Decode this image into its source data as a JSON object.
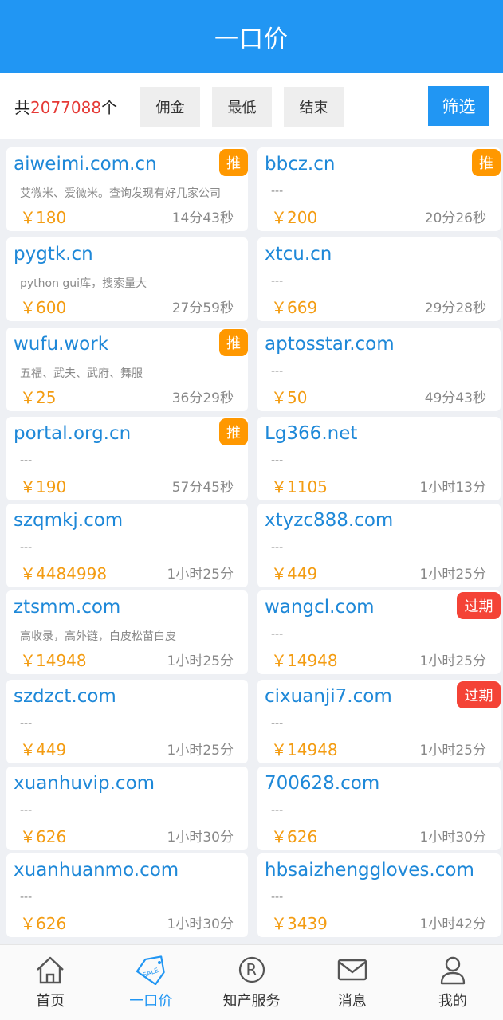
{
  "header": {
    "title": "一口价"
  },
  "filter": {
    "count_prefix": "共",
    "count_value": "2077088",
    "count_suffix": "个",
    "sort_buttons": [
      "佣金",
      "最低",
      "结束"
    ],
    "filter_label": "筛选"
  },
  "listings": [
    {
      "domain": "aiweimi.com.cn",
      "desc": "艾微米、爱微米。查询发现有好几家公司",
      "price": "￥180",
      "time": "14分43秒",
      "badge": "推",
      "badge_type": "tui"
    },
    {
      "domain": "bbcz.cn",
      "desc": "---",
      "price": "￥200",
      "time": "20分26秒",
      "badge": "推",
      "badge_type": "tui"
    },
    {
      "domain": "pygtk.cn",
      "desc": "python gui库，搜索量大",
      "price": "￥600",
      "time": "27分59秒",
      "badge": "",
      "badge_type": ""
    },
    {
      "domain": "xtcu.cn",
      "desc": "---",
      "price": "￥669",
      "time": "29分28秒",
      "badge": "",
      "badge_type": ""
    },
    {
      "domain": "wufu.work",
      "desc": "五福、武夫、武府、舞服",
      "price": "￥25",
      "time": "36分29秒",
      "badge": "推",
      "badge_type": "tui"
    },
    {
      "domain": "aptosstar.com",
      "desc": "---",
      "price": "￥50",
      "time": "49分43秒",
      "badge": "",
      "badge_type": ""
    },
    {
      "domain": "portal.org.cn",
      "desc": "---",
      "price": "￥190",
      "time": "57分45秒",
      "badge": "推",
      "badge_type": "tui"
    },
    {
      "domain": "Lg366.net",
      "desc": "---",
      "price": "￥1105",
      "time": "1小时13分",
      "badge": "",
      "badge_type": ""
    },
    {
      "domain": "szqmkj.com",
      "desc": "---",
      "price": "￥4484998",
      "time": "1小时25分",
      "badge": "",
      "badge_type": ""
    },
    {
      "domain": "xtyzc888.com",
      "desc": "---",
      "price": "￥449",
      "time": "1小时25分",
      "badge": "",
      "badge_type": ""
    },
    {
      "domain": "ztsmm.com",
      "desc": "高收录，高外链，白皮松苗白皮",
      "price": "￥14948",
      "time": "1小时25分",
      "badge": "",
      "badge_type": ""
    },
    {
      "domain": "wangcl.com",
      "desc": "---",
      "price": "￥14948",
      "time": "1小时25分",
      "badge": "过期",
      "badge_type": "guoqi"
    },
    {
      "domain": "szdzct.com",
      "desc": "---",
      "price": "￥449",
      "time": "1小时25分",
      "badge": "",
      "badge_type": ""
    },
    {
      "domain": "cixuanji7.com",
      "desc": "---",
      "price": "￥14948",
      "time": "1小时25分",
      "badge": "过期",
      "badge_type": "guoqi"
    },
    {
      "domain": "xuanhuvip.com",
      "desc": "---",
      "price": "￥626",
      "time": "1小时30分",
      "badge": "",
      "badge_type": ""
    },
    {
      "domain": "700628.com",
      "desc": "---",
      "price": "￥626",
      "time": "1小时30分",
      "badge": "",
      "badge_type": ""
    },
    {
      "domain": "xuanhuanmo.com",
      "desc": "---",
      "price": "￥626",
      "time": "1小时30分",
      "badge": "",
      "badge_type": ""
    },
    {
      "domain": "hbsaizhenggloves.com",
      "desc": "---",
      "price": "￥3439",
      "time": "1小时42分",
      "badge": "",
      "badge_type": ""
    }
  ],
  "tabbar": {
    "items": [
      {
        "label": "首页",
        "icon": "home-icon",
        "active": false
      },
      {
        "label": "一口价",
        "icon": "sale-tag-icon",
        "active": true
      },
      {
        "label": "知产服务",
        "icon": "registered-icon",
        "active": false
      },
      {
        "label": "消息",
        "icon": "mail-icon",
        "active": false
      },
      {
        "label": "我的",
        "icon": "user-icon",
        "active": false
      }
    ]
  },
  "colors": {
    "primary": "#2196f3",
    "price": "#f39c12",
    "badge_recommend": "#ff9800",
    "badge_expired": "#f44336",
    "count": "#e53935"
  }
}
